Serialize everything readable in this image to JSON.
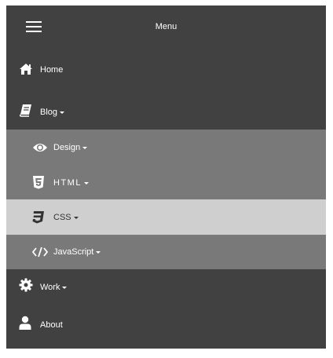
{
  "header": {
    "title": "Menu",
    "menu_icon": "hamburger-icon"
  },
  "items": [
    {
      "id": "home",
      "label": "Home",
      "icon": "home-icon",
      "has_caret": false
    },
    {
      "id": "blog",
      "label": "Blog",
      "icon": "book-icon",
      "has_caret": true,
      "children": [
        {
          "id": "design",
          "label": "Design",
          "icon": "eye-icon",
          "has_caret": true
        },
        {
          "id": "html",
          "label": "HTML",
          "icon": "html5-icon",
          "has_caret": true
        },
        {
          "id": "css",
          "label": "CSS",
          "icon": "css3-icon",
          "has_caret": true,
          "selected": true
        },
        {
          "id": "javascript",
          "label": "JavaScript",
          "icon": "code-icon",
          "has_caret": true
        }
      ]
    },
    {
      "id": "work",
      "label": "Work",
      "icon": "gear-icon",
      "has_caret": true
    },
    {
      "id": "about",
      "label": "About",
      "icon": "user-icon",
      "has_caret": false
    }
  ],
  "colors": {
    "menu_bg": "#414141",
    "submenu_bg": "#797979",
    "selected_bg": "#cfcfcf",
    "text": "#ffffff",
    "selected_text": "#333333"
  }
}
